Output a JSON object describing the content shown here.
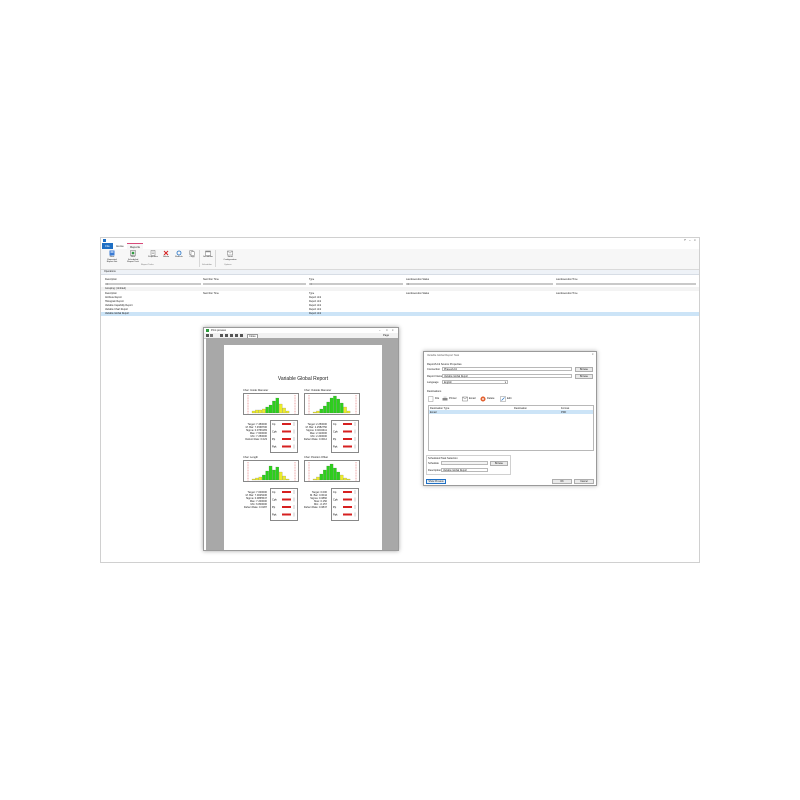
{
  "app": {
    "ribbon_tabs": [
      "File",
      "Home",
      "Reports"
    ],
    "ribbon_buttons": [
      {
        "label": "New Repeated Report Set",
        "icon": "report-set-icon"
      },
      {
        "label": "New Scheduled Report Task",
        "icon": "schedule-icon"
      },
      {
        "label": "Properties",
        "icon": "properties-icon"
      },
      {
        "label": "Delete",
        "icon": "delete-icon"
      },
      {
        "label": "Refresh",
        "icon": "refresh-icon"
      },
      {
        "label": "Copy",
        "icon": "copy-icon"
      },
      {
        "label": "Scheduler",
        "icon": "scheduler-icon"
      },
      {
        "label": "Send Configuration",
        "icon": "send-icon"
      }
    ],
    "ribbon_groups": [
      "Report Tasks",
      "Scheduler",
      "Options"
    ],
    "panel_title": "Operations",
    "columns_top": [
      "Description",
      "Next Run Time",
      "Type",
      "Last Execution Status",
      "Last Execution Time"
    ],
    "filter_row": [
      "=",
      "",
      "=",
      "=",
      ""
    ],
    "grouping_label": "Grouping: (Untitled)",
    "columns_bottom": [
      "Description",
      "Next Run Time",
      "Type",
      "Last Execution Status",
      "Last Execution Time"
    ],
    "rows": [
      {
        "description": "Attribute Report",
        "type": "Report Unit"
      },
      {
        "description": "Histogram Report",
        "type": "Report Unit"
      },
      {
        "description": "Variable Capability Report",
        "type": "Report Unit"
      },
      {
        "description": "Variable Chart Report",
        "type": "Report Unit"
      },
      {
        "description": "Variable Global Report",
        "type": "Report Unit"
      }
    ]
  },
  "preview": {
    "window_title": "Print preview",
    "toolbar_close": "Close",
    "toolbar_page": "Page",
    "report_title": "Variable Global Report",
    "charts": [
      {
        "title": "Char: Inside Diameter",
        "stats": [
          "Target: 7.450000",
          "M. Bar: 7.4568706",
          "Sigma: 0.0766183",
          "Max: 7.600000",
          "Min: 7.250000",
          "Defect Rate: 0.023"
        ]
      },
      {
        "title": "Char: Outside Diameter",
        "stats": [
          "Target: 2.250000",
          "M. Bar: 2.2582750",
          "Sigma: 0.0243411",
          "Max: 2.310000",
          "Min: 2.200000",
          "Defect Rate: 0.0012"
        ]
      },
      {
        "title": "Char: Length",
        "stats": [
          "Target: 7.000000",
          "M. Bar: 7.0025236",
          "Sigma: 0.0865547",
          "Max: 7.200000",
          "Min: 6.800000",
          "Defect Rate: 0.0187"
        ]
      },
      {
        "title": "Char: Position Offset",
        "stats": [
          "Target: 0.000",
          "M. Bar: 0.0044",
          "Sigma: 0.0860",
          "Max: 0.150",
          "Min: -0.157",
          "Defect Rate: 0.0847"
        ]
      }
    ],
    "control_labels": [
      "Cp",
      "Cpk",
      "Pp",
      "Ppk"
    ]
  },
  "dialog": {
    "title": "Variable Global Report Task",
    "section_source": "Report/Unit Source Properties",
    "label_connection": "Connection",
    "value_connection": "Phases/Unit",
    "browse_label": "Browse",
    "label_report_name": "Report Name",
    "value_report_name": "Variable Global Report",
    "label_language": "Language",
    "value_language": "English",
    "section_destinations": "Destinations",
    "dest_buttons": [
      "File",
      "Printer",
      "Email",
      "Delete",
      "Edit"
    ],
    "dest_columns": [
      "Destination Type",
      "Destination",
      "Format"
    ],
    "dest_row": {
      "type": "Email",
      "destination": "",
      "format": "PDF"
    },
    "section_scheduled": "Scheduled Task Selection",
    "label_schedule": "Schedule",
    "label_description": "Description",
    "value_description": "Variable Global Report",
    "show_preview": "Show Preview",
    "ok": "OK",
    "cancel": "Cancel"
  },
  "colors": {
    "accent": "#1e6fc4",
    "bar_green": "#2dcf1d",
    "bar_yellow": "#ecec2a",
    "limit_red": "#d62020",
    "row_selected": "#cce4f7"
  }
}
